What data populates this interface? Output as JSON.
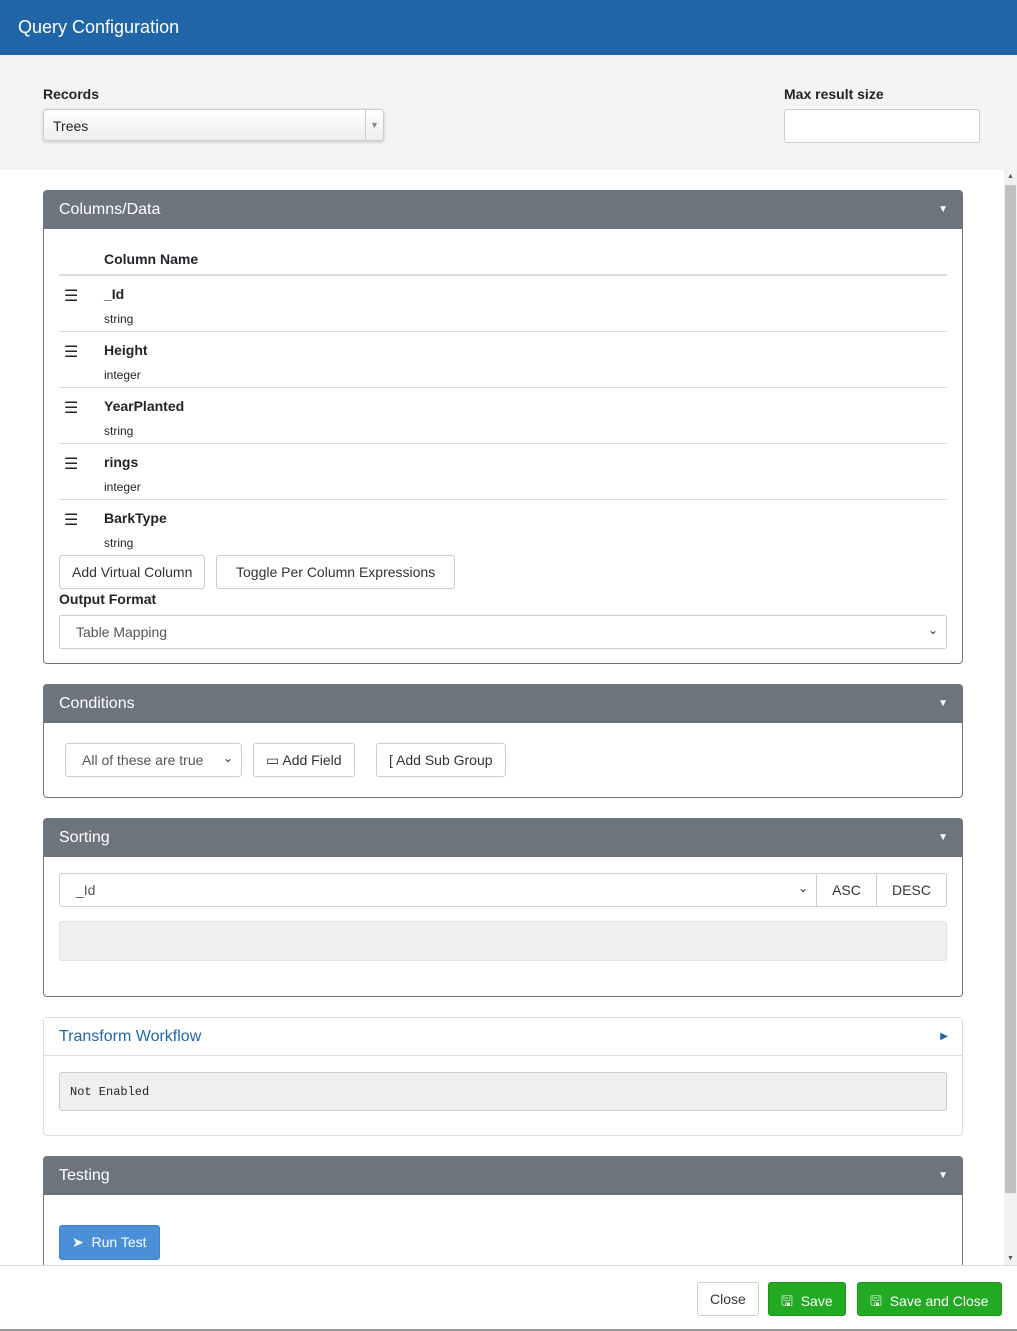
{
  "title": "Query Configuration",
  "records": {
    "label": "Records",
    "value": "Trees"
  },
  "max_result": {
    "label": "Max result size",
    "value": ""
  },
  "columns_panel": {
    "title": "Columns/Data",
    "header": "Column Name",
    "columns": [
      {
        "name": "_Id",
        "type": "string"
      },
      {
        "name": "Height",
        "type": "integer"
      },
      {
        "name": "YearPlanted",
        "type": "string"
      },
      {
        "name": "rings",
        "type": "integer"
      },
      {
        "name": "BarkType",
        "type": "string"
      }
    ],
    "add_virtual": "Add Virtual Column",
    "toggle_expr": "Toggle Per Column Expressions",
    "output_label": "Output Format",
    "output_value": "Table Mapping"
  },
  "conditions": {
    "title": "Conditions",
    "mode": "All of these are true",
    "add_field": "Add Field",
    "add_group": "Add Sub Group"
  },
  "sorting": {
    "title": "Sorting",
    "field": "_Id",
    "asc": "ASC",
    "desc": "DESC"
  },
  "transform": {
    "title": "Transform Workflow",
    "status": "Not Enabled"
  },
  "testing": {
    "title": "Testing",
    "run": "Run Test"
  },
  "footer": {
    "close": "Close",
    "save": "Save",
    "save_close": "Save and Close"
  },
  "colors": {
    "header": "#2165a9",
    "panel_header": "#6c757d",
    "success": "#22aa22",
    "primary": "#4a90d9"
  }
}
